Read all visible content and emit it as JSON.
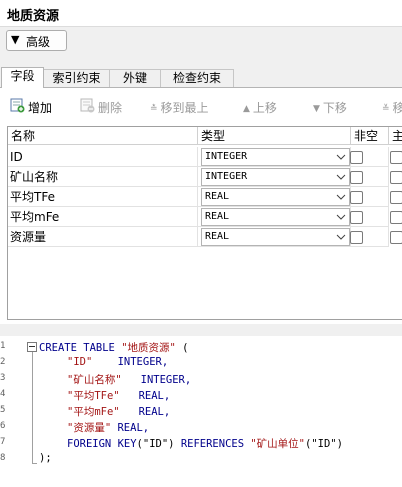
{
  "window": {
    "title": "地质资源"
  },
  "advanced": {
    "arrow": "▼",
    "label": "高级"
  },
  "tabs": [
    {
      "label": "字段",
      "active": true
    },
    {
      "label": "索引约束",
      "active": false
    },
    {
      "label": "外键",
      "active": false
    },
    {
      "label": "检查约束",
      "active": false
    }
  ],
  "toolbar": {
    "add": "增加",
    "delete": "删除",
    "move_top": "移到最上",
    "move_up": "上移",
    "move_down": "下移",
    "move_bottom_partial": "移"
  },
  "grid": {
    "headers": {
      "name": "名称",
      "type": "类型",
      "notnull": "非空",
      "primary_partial": "主"
    },
    "rows": [
      {
        "name": "ID",
        "type": "INTEGER"
      },
      {
        "name": "矿山名称",
        "type": "INTEGER"
      },
      {
        "name": "平均TFe",
        "type": "REAL"
      },
      {
        "name": "平均mFe",
        "type": "REAL"
      },
      {
        "name": "资源量",
        "type": "REAL"
      }
    ]
  },
  "sql": {
    "line_numbers": [
      "1",
      "2",
      "3",
      "4",
      "5",
      "6",
      "7",
      "8"
    ],
    "l1_kw": "CREATE TABLE",
    "l1_name": "\"地质资源\"",
    "l1_paren": " (",
    "l2_col": "\"ID\"",
    "l2_type": "INTEGER,",
    "l3_col": "\"矿山名称\"",
    "l3_type": "INTEGER,",
    "l4_col": "\"平均TFe\"",
    "l4_type": "REAL,",
    "l5_col": "\"平均mFe\"",
    "l5_type": "REAL,",
    "l6_col": "\"资源量\"",
    "l6_type": "REAL,",
    "l7_kw": "FOREIGN KEY",
    "l7_mid1": "(\"ID\") ",
    "l7_ref": "REFERENCES",
    "l7_tbl": "\"矿山单位\"",
    "l7_end": "(\"ID\")",
    "l8": ");"
  }
}
